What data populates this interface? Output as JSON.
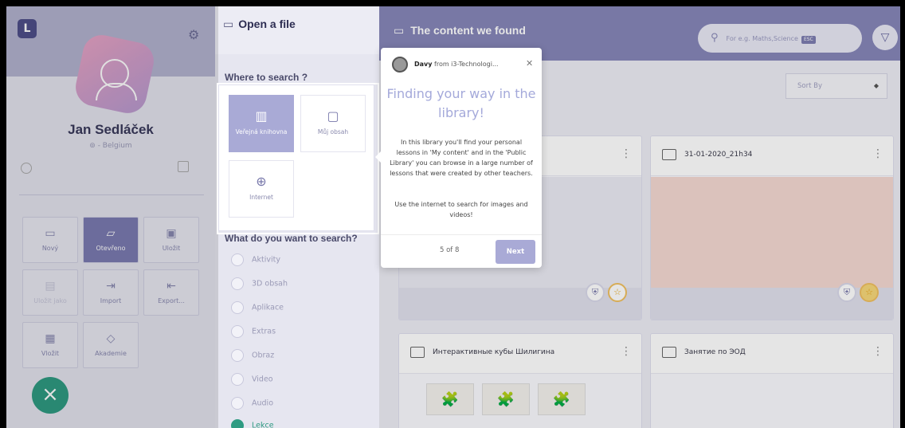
{
  "sidebar": {
    "logo": "L",
    "user_name": "Jan Sedláček",
    "user_location": "- Belgium",
    "tiles": [
      {
        "label": "Nový",
        "icon": "new-icon"
      },
      {
        "label": "Otevřeno",
        "icon": "open-folder-icon"
      },
      {
        "label": "Uložit",
        "icon": "save-icon"
      },
      {
        "label": "Uložit jako",
        "icon": "save-as-icon"
      },
      {
        "label": "Import",
        "icon": "import-icon"
      },
      {
        "label": "Export...",
        "icon": "export-icon"
      },
      {
        "label": "Vložit",
        "icon": "insert-icon"
      },
      {
        "label": "Akademie",
        "icon": "academy-icon"
      }
    ],
    "fab_label": "×"
  },
  "search_panel": {
    "title": "Open a file",
    "where_label": "Where to search ?",
    "sources": [
      {
        "label": "Veřejná knihovna",
        "icon": "library-icon"
      },
      {
        "label": "Můj obsah",
        "icon": "my-content-icon"
      },
      {
        "label": "Internet",
        "icon": "globe-icon"
      }
    ],
    "what_label": "What do you want to search?",
    "types": [
      "Aktivity",
      "3D obsah",
      "Aplikace",
      "Extras",
      "Obraz",
      "Video",
      "Audio",
      "Lekce"
    ]
  },
  "main": {
    "title": "The content we found",
    "search_placeholder": "For e.g. Maths,Science",
    "search_kbd": "ESC",
    "sort_label": "Sort By",
    "cards": [
      {
        "title": ""
      },
      {
        "title": "31-01-2020_21h34"
      },
      {
        "title": "Интерактивные кубы Шилигина"
      },
      {
        "title": "Занятие по ЭОД"
      }
    ]
  },
  "tooltip": {
    "from_name": "Davy",
    "from_org": "from i3-Technologi...",
    "title": "Finding your way in the library!",
    "body": "In this library you'll find your personal lessons in 'My content' and in the 'Public Library' you can browse in a large number of lessons that were created by other teachers.",
    "body2": "Use the internet to search for images and videos!",
    "step": "5 of 8",
    "next_label": "Next"
  },
  "colors": {
    "accent": "#8686b8",
    "fab": "#2f9b82",
    "tooltip_title": "#a4a9da"
  }
}
